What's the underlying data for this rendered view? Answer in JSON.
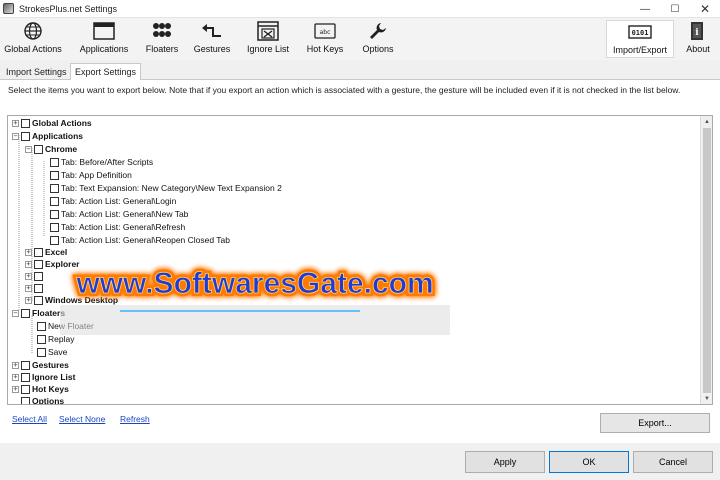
{
  "window": {
    "title": "StrokesPlus.net Settings",
    "minimize_glyph": "—",
    "maximize_glyph": "☐",
    "close_glyph": "✕"
  },
  "toolbar": {
    "items": [
      {
        "label": "Global Actions",
        "icon": "globe-icon"
      },
      {
        "label": "Applications",
        "icon": "window-icon"
      },
      {
        "label": "Floaters",
        "icon": "floaters-icon"
      },
      {
        "label": "Gestures",
        "icon": "gesture-arrow-icon"
      },
      {
        "label": "Ignore List",
        "icon": "ignore-list-icon"
      },
      {
        "label": "Hot Keys",
        "icon": "keyboard-icon"
      },
      {
        "label": "Options",
        "icon": "wrench-icon"
      },
      {
        "label": "Import/Export",
        "icon": "binary-icon"
      },
      {
        "label": "About",
        "icon": "info-book-icon"
      }
    ]
  },
  "tabs": [
    {
      "label": "Import Settings",
      "active": false
    },
    {
      "label": "Export Settings",
      "active": true
    }
  ],
  "description": "Select the items you want to export below. Note that if you export an action which is associated with a gesture, the gesture will be included even if it is not checked in the list below.",
  "tree": {
    "rows": [
      {
        "label": "Global Actions",
        "bold": true,
        "expander": "+"
      },
      {
        "label": "Applications",
        "bold": true,
        "expander": "−"
      },
      {
        "label": "Chrome",
        "bold": true,
        "expander": "−"
      },
      {
        "label": "Tab: Before/After Scripts",
        "bold": false,
        "expander": ""
      },
      {
        "label": "Tab: App Definition",
        "bold": false,
        "expander": ""
      },
      {
        "label": "Tab: Text Expansion: New Category\\New Text Expansion 2",
        "bold": false,
        "expander": ""
      },
      {
        "label": "Tab: Action List: General\\Login",
        "bold": false,
        "expander": ""
      },
      {
        "label": "Tab: Action List: General\\New Tab",
        "bold": false,
        "expander": ""
      },
      {
        "label": "Tab: Action List: General\\Refresh",
        "bold": false,
        "expander": ""
      },
      {
        "label": "Tab: Action List: General\\Reopen Closed Tab",
        "bold": false,
        "expander": ""
      },
      {
        "label": "Excel",
        "bold": true,
        "expander": "+"
      },
      {
        "label": "Explorer",
        "bold": true,
        "expander": "+"
      },
      {
        "label": "",
        "bold": true,
        "expander": "+"
      },
      {
        "label": "",
        "bold": true,
        "expander": "+"
      },
      {
        "label": "Windows Desktop",
        "bold": true,
        "expander": "+"
      },
      {
        "label": "Floaters",
        "bold": true,
        "expander": "−"
      },
      {
        "label": "New Floater",
        "bold": false,
        "expander": ""
      },
      {
        "label": "Replay",
        "bold": false,
        "expander": ""
      },
      {
        "label": "Save",
        "bold": false,
        "expander": ""
      },
      {
        "label": "Gestures",
        "bold": true,
        "expander": "+"
      },
      {
        "label": "Ignore List",
        "bold": true,
        "expander": "+"
      },
      {
        "label": "Hot Keys",
        "bold": true,
        "expander": "+"
      },
      {
        "label": "Options",
        "bold": true,
        "expander": ""
      }
    ]
  },
  "links": {
    "select_all": "Select All",
    "select_none": "Select None",
    "refresh": "Refresh"
  },
  "buttons": {
    "export": "Export...",
    "apply": "Apply",
    "ok": "OK",
    "cancel": "Cancel"
  },
  "watermark": {
    "text": "www.SoftwaresGate.com"
  },
  "colors": {
    "link": "#1a46c0",
    "watermark_text": "#1f3bd6",
    "watermark_glow": "#ff4a00",
    "default_button_border": "#0078d7"
  }
}
